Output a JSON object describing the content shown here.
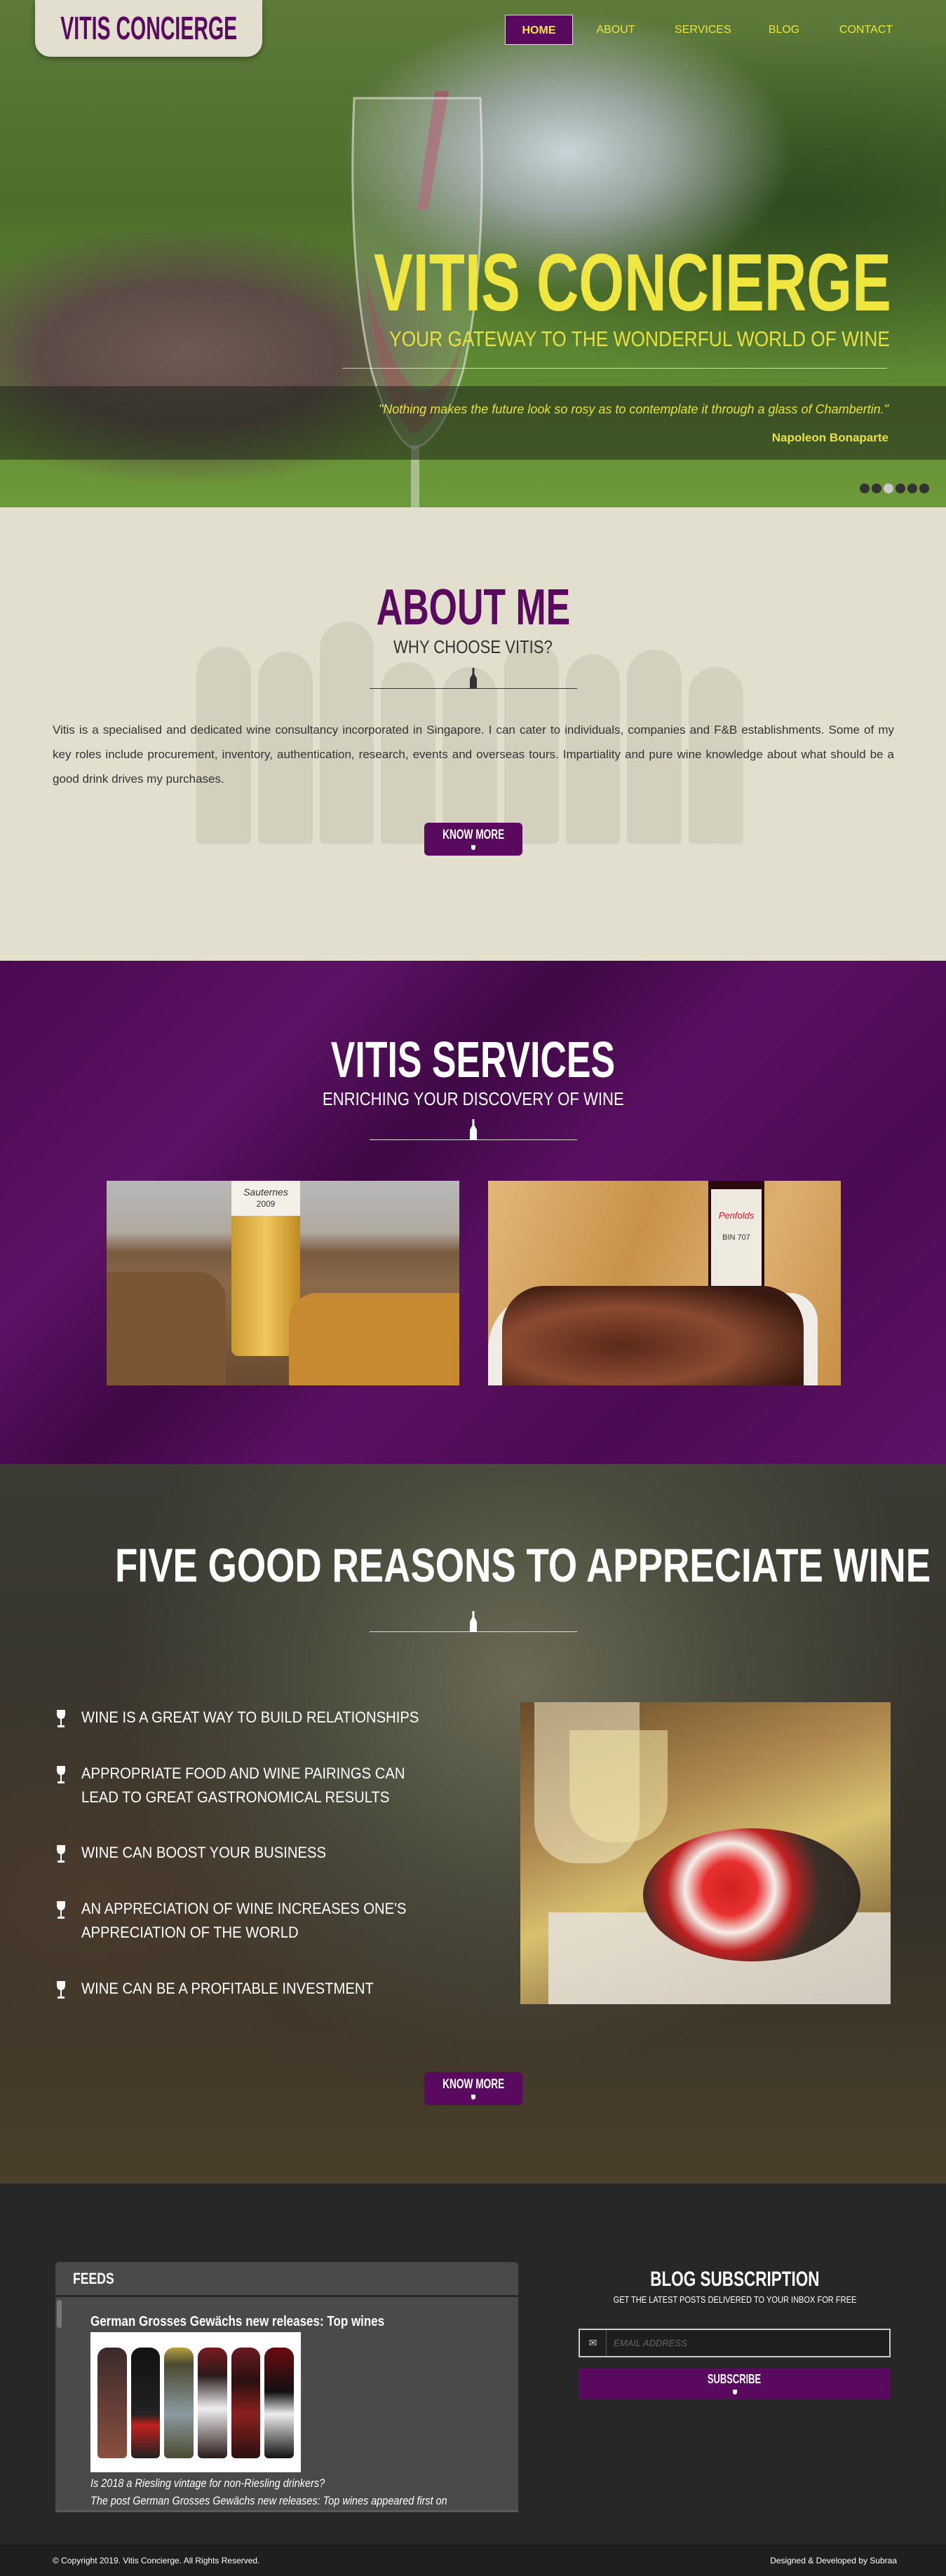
{
  "brand": {
    "logo": "VITIS CONCIERGE"
  },
  "nav": {
    "items": [
      {
        "label": "HOME",
        "active": true
      },
      {
        "label": "ABOUT"
      },
      {
        "label": "SERVICES"
      },
      {
        "label": "BLOG"
      },
      {
        "label": "CONTACT"
      }
    ]
  },
  "hero": {
    "title": "VITIS CONCIERGE",
    "subtitle": "YOUR GATEWAY TO THE WONDERFUL WORLD OF WINE",
    "quote": "\"Nothing makes the future look so rosy as to contemplate it through a glass of Chambertin.\"",
    "author": "Napoleon Bonaparte",
    "slides": 6,
    "active_slide": 3
  },
  "about": {
    "title": "ABOUT ME",
    "subtitle": "WHY CHOOSE VITIS?",
    "paragraph": "Vitis is a specialised and dedicated wine consultancy incorporated in Singapore. I can cater to individuals, companies and F&B establishments. Some of my key roles include procurement, inventory, authentication, research, events and overseas tours. Impartiality and pure wine knowledge about what should be a good drink drives my purchases.",
    "button": "KNOW MORE"
  },
  "services": {
    "title": "VITIS SERVICES",
    "subtitle": "ENRICHING YOUR DISCOVERY OF WINE",
    "images": [
      {
        "label": "Sauternes",
        "year": "2009"
      },
      {
        "label": "Penfolds",
        "sub": "BIN 707"
      }
    ]
  },
  "reasons": {
    "title": "FIVE GOOD REASONS TO APPRECIATE WINE",
    "items": [
      "WINE IS A GREAT WAY TO BUILD RELATIONSHIPS",
      "APPROPRIATE FOOD AND WINE PAIRINGS CAN LEAD TO GREAT GASTRONOMICAL RESULTS",
      "WINE CAN BOOST YOUR BUSINESS",
      "AN APPRECIATION OF WINE INCREASES ONE'S APPRECIATION OF THE WORLD",
      "WINE CAN BE A PROFITABLE INVESTMENT"
    ],
    "button": "KNOW MORE"
  },
  "feeds": {
    "title": "FEEDS",
    "post_title": "German Grosses Gewächs new releases: Top wines",
    "line1": "Is 2018 a Riesling vintage for non-Riesling drinkers?",
    "line2": "The post German Grosses Gewächs new releases: Top wines appeared first on"
  },
  "subscription": {
    "title": "BLOG SUBSCRIPTION",
    "subtitle": "GET THE LATEST POSTS DELIVERED TO YOUR INBOX FOR FREE",
    "email_placeholder": "EMAIL ADDRESS",
    "button": "SUBSCRIBE"
  },
  "footer": {
    "copyright": "© Copyright 2019. Vitis Concierge. All Rights Reserved.",
    "credit": "Designed & Developed by Subraa"
  },
  "colors": {
    "purple": "#5a0a5e",
    "yellow": "#f0e640",
    "cream": "#e2dfcf",
    "dark": "#272727"
  }
}
